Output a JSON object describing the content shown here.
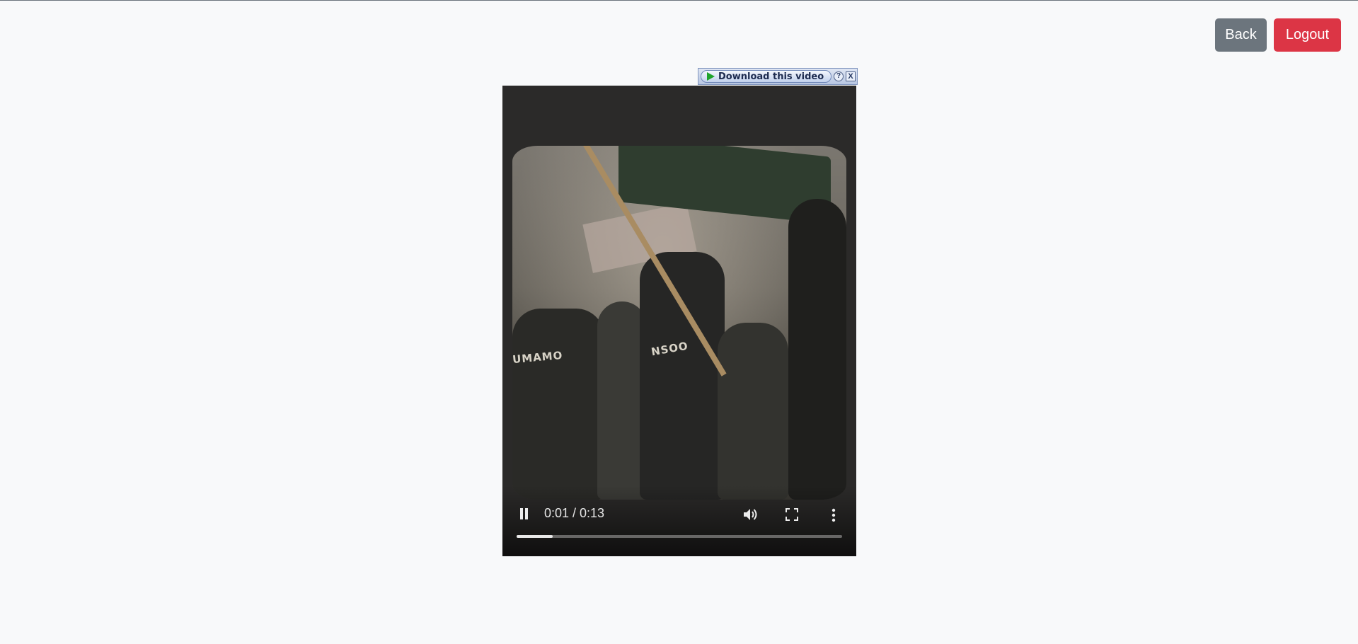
{
  "header": {
    "back_label": "Back",
    "logout_label": "Logout",
    "back_color": "#6c757d",
    "logout_color": "#dc3545"
  },
  "download_bar": {
    "button_label": "Download this video",
    "help_label": "?",
    "close_label": "X",
    "play_icon": "play-icon"
  },
  "video": {
    "shirt_text_1": "UMAMO",
    "shirt_text_2": "NSOO",
    "current_time": "0:01",
    "duration": "0:13",
    "time_display": "0:01 / 0:13",
    "progress_fraction": 0.11,
    "icons": [
      "pause-icon",
      "volume-icon",
      "fullscreen-icon",
      "more-options-icon"
    ]
  }
}
